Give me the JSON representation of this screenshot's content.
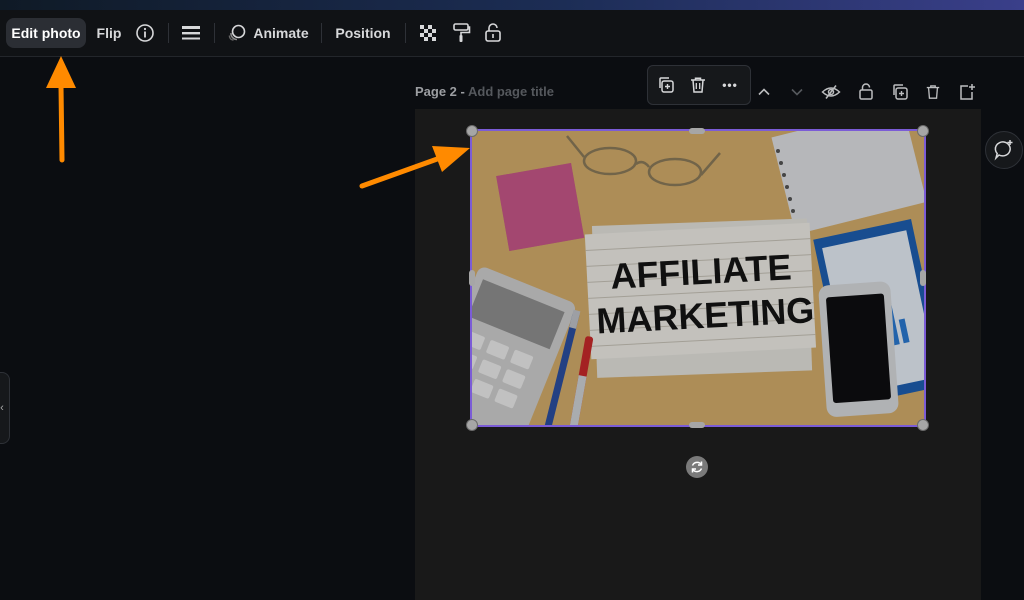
{
  "toolbar": {
    "edit_photo": "Edit photo",
    "flip": "Flip",
    "animate": "Animate",
    "position": "Position",
    "icons": [
      "info-icon",
      "line-weight-icon",
      "animate-icon",
      "transparency-icon",
      "paint-roller-icon",
      "lock-icon"
    ]
  },
  "page": {
    "label": "Page 2 - ",
    "title_placeholder": "Add page title",
    "page_icons": [
      "chevron-up-icon",
      "chevron-down-icon",
      "hide-icon",
      "lock-icon",
      "duplicate-icon",
      "delete-icon",
      "add-page-icon"
    ]
  },
  "floating_toolbar": {
    "icons": [
      "duplicate-icon",
      "delete-icon",
      "more-icon"
    ],
    "more_label": "•••"
  },
  "photo": {
    "line1": "AFFILIATE",
    "line2": "MARKETING"
  },
  "sidebar": {
    "collapse_glyph": "‹"
  },
  "colors": {
    "background": "#0b0d11",
    "toolbar": "#101215",
    "canvas": "#191919",
    "selection": "#7b5cd6",
    "annotation_arrow": "#ff8a00"
  }
}
